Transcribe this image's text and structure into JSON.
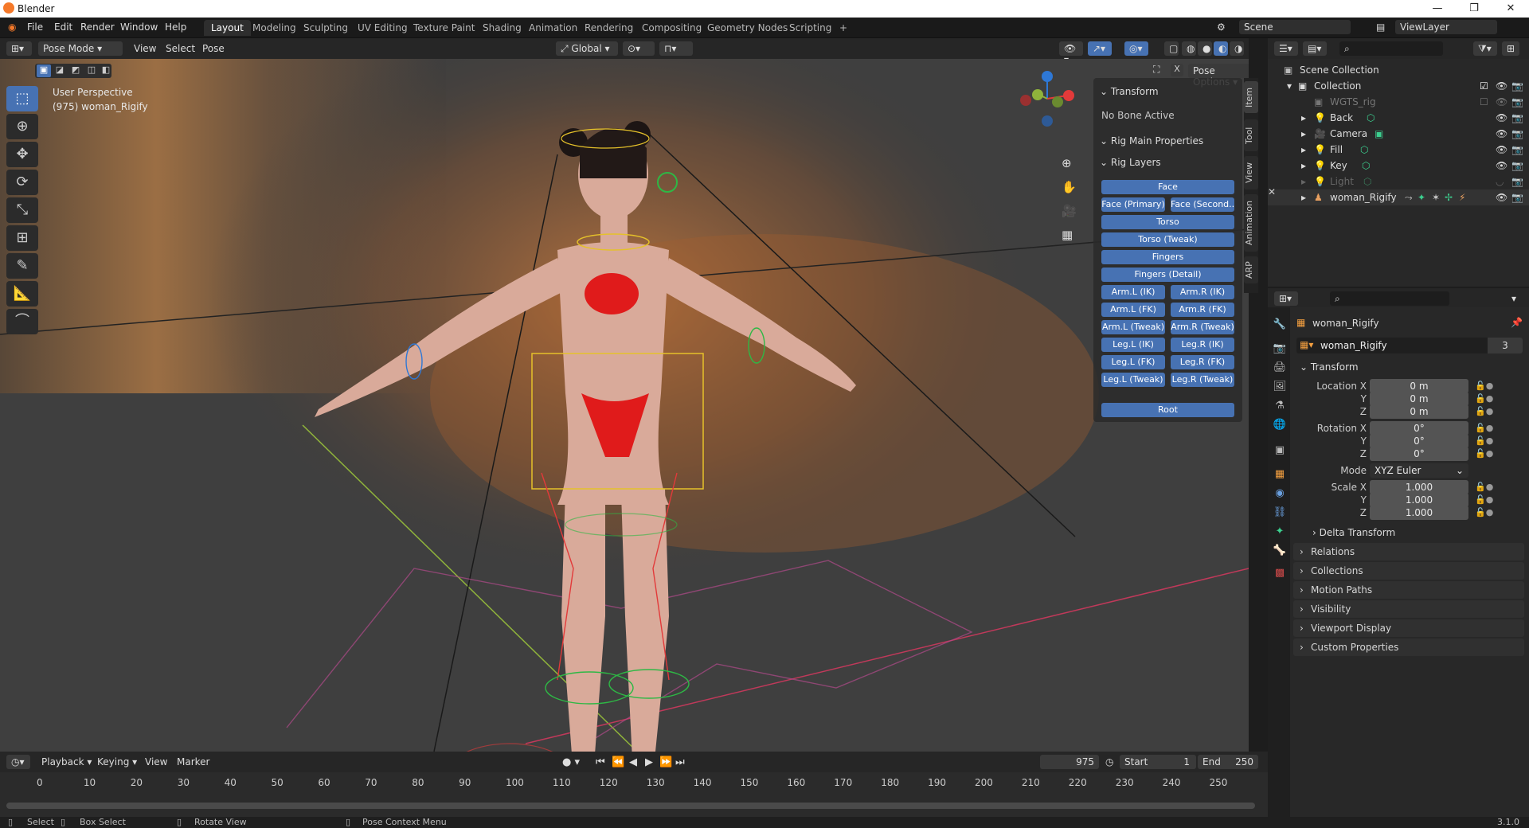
{
  "app": {
    "title": "Blender",
    "version": "3.1.0"
  },
  "menu": [
    "File",
    "Edit",
    "Render",
    "Window",
    "Help"
  ],
  "workspaces": [
    "Layout",
    "Modeling",
    "Sculpting",
    "UV Editing",
    "Texture Paint",
    "Shading",
    "Animation",
    "Rendering",
    "Compositing",
    "Geometry Nodes",
    "Scripting"
  ],
  "scene": "Scene",
  "view_layer": "ViewLayer",
  "viewport_header": {
    "mode": "Pose Mode",
    "view": "View",
    "select": "Select",
    "pose": "Pose",
    "orientation": "Global",
    "pose_options": "Pose Options"
  },
  "viewport": {
    "perspective": "User Perspective",
    "object_info": "(975) woman_Rigify"
  },
  "npanel": {
    "transform": "Transform",
    "no_bone": "No Bone Active",
    "rig_main": "Rig Main Properties",
    "rig_layers": "Rig Layers",
    "buttons": {
      "face": "Face",
      "face_primary": "Face (Primary)",
      "face_secondary": "Face (Second...",
      "torso": "Torso",
      "torso_tweak": "Torso (Tweak)",
      "fingers": "Fingers",
      "fingers_detail": "Fingers (Detail)",
      "arm_l_ik": "Arm.L (IK)",
      "arm_r_ik": "Arm.R (IK)",
      "arm_l_fk": "Arm.L (FK)",
      "arm_r_fk": "Arm.R (FK)",
      "arm_l_tweak": "Arm.L (Tweak)",
      "arm_r_tweak": "Arm.R (Tweak)",
      "leg_l_ik": "Leg.L (IK)",
      "leg_r_ik": "Leg.R (IK)",
      "leg_l_fk": "Leg.L (FK)",
      "leg_r_fk": "Leg.R (FK)",
      "leg_l_tweak": "Leg.L (Tweak)",
      "leg_r_tweak": "Leg.R (Tweak)",
      "root": "Root"
    },
    "tabs": [
      "Item",
      "Tool",
      "View",
      "Animation",
      "ARP"
    ]
  },
  "outliner": {
    "root": "Scene Collection",
    "items": [
      {
        "name": "Collection"
      },
      {
        "name": "WGTS_rig"
      },
      {
        "name": "Back"
      },
      {
        "name": "Camera"
      },
      {
        "name": "Fill"
      },
      {
        "name": "Key"
      },
      {
        "name": "Light"
      },
      {
        "name": "woman_Rigify"
      }
    ]
  },
  "properties": {
    "object_name": "woman_Rigify",
    "datablock": "woman_Rigify",
    "users": "3",
    "transform": "Transform",
    "location_label": "Location X",
    "rotation_label": "Rotation X",
    "scale_label": "Scale X",
    "y": "Y",
    "z": "Z",
    "loc": [
      "0 m",
      "0 m",
      "0 m"
    ],
    "rot": [
      "0°",
      "0°",
      "0°"
    ],
    "mode_label": "Mode",
    "mode": "XYZ Euler",
    "scale": [
      "1.000",
      "1.000",
      "1.000"
    ],
    "sections": [
      "Delta Transform",
      "Relations",
      "Collections",
      "Motion Paths",
      "Visibility",
      "Viewport Display",
      "Custom Properties"
    ]
  },
  "timeline": {
    "playback": "Playback",
    "keying": "Keying",
    "view": "View",
    "marker": "Marker",
    "current_frame": "975",
    "start_label": "Start",
    "start": "1",
    "end_label": "End",
    "end": "250",
    "ticks": [
      "0",
      "10",
      "20",
      "30",
      "40",
      "50",
      "60",
      "70",
      "80",
      "90",
      "100",
      "110",
      "120",
      "130",
      "140",
      "150",
      "160",
      "170",
      "180",
      "190",
      "200",
      "210",
      "220",
      "230",
      "240",
      "250"
    ]
  },
  "status": {
    "select": "Select",
    "box_select": "Box Select",
    "rotate": "Rotate View",
    "context": "Pose Context Menu"
  }
}
